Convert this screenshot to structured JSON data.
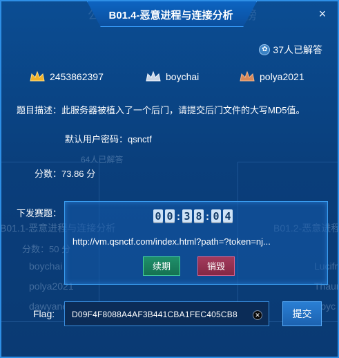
{
  "modal": {
    "title": "B01.4-恶意进程与连接分析",
    "close_symbol": "×",
    "solved_count": "37人已解答"
  },
  "ranking": [
    {
      "name": "2453862397",
      "medal": "gold"
    },
    {
      "name": "boychai",
      "medal": "silver"
    },
    {
      "name": "polya2021",
      "medal": "bronze"
    }
  ],
  "description": "题目描述：此服务器被植入了一个后门，请提交后门文件的大写MD5值。",
  "default_password": "默认用户密码：qsnctf",
  "score": "分数：73.86 分",
  "dispatch": {
    "label": "下发赛题：",
    "timer": {
      "h1": "0",
      "h2": "0",
      "m1": "3",
      "m2": "8",
      "s1": "0",
      "s2": "4",
      "sep": ":"
    },
    "url": "http://vm.qsnctf.com/index.html?path=?token=nj...",
    "renew_label": "续期",
    "destroy_label": "销毁"
  },
  "flag": {
    "label": "Flag:",
    "value": "D09F4F8088A4AF3B441CBA1FEC405CB8",
    "submit_label": "提交"
  },
  "background": {
    "header_fragment_left": "公",
    "header_fragment_right": "榜",
    "solved_ghost": "64人已解答",
    "card_left_title": "B01.1-恶意进程与连接分析",
    "card_right_title": "B01.2-恶意进程",
    "card_left_score": "分数：50 分",
    "names_left": [
      "boychai",
      "polya2021",
      "dawyane"
    ],
    "names_right": [
      "Lucifr",
      "Thaum",
      "Boyc"
    ]
  },
  "colors": {
    "accent": "#2e8fe6",
    "renew": "#1f8f6a",
    "destroy": "#a33a5c",
    "panel_bg": "#0a3f7c"
  }
}
